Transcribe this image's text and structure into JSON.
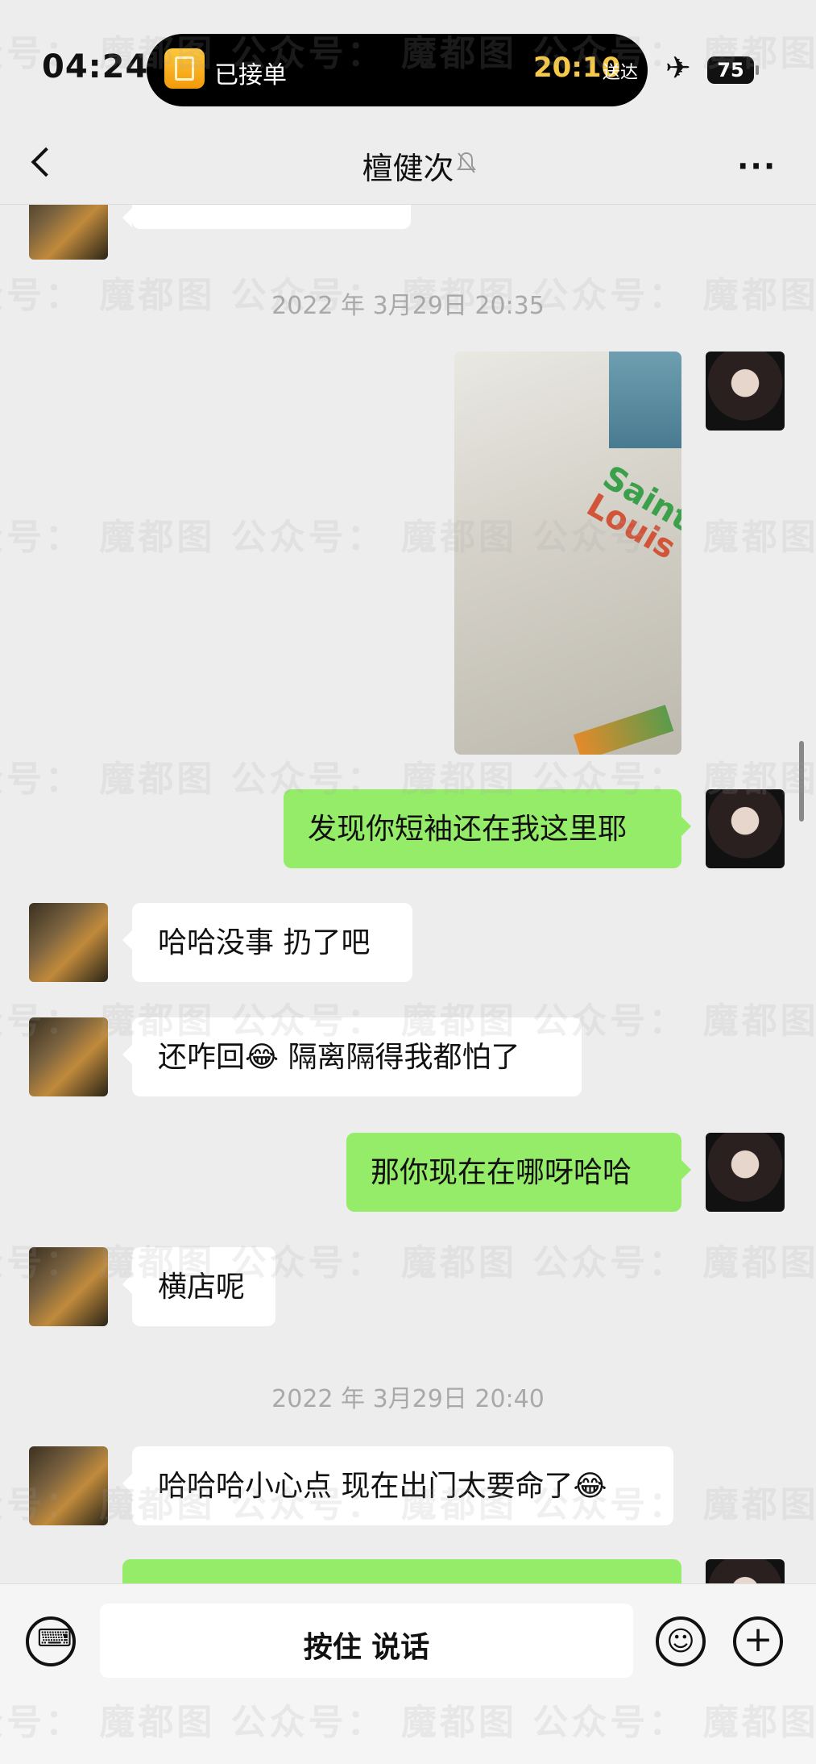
{
  "status_bar": {
    "time": "04:24",
    "island_label": "已接单",
    "island_eta": "20:10",
    "island_eta_suffix": "送达",
    "battery": "75"
  },
  "nav": {
    "title": "檀健次"
  },
  "chat": {
    "items": [
      {
        "type": "timestamp",
        "text": "2022 年 3月29日 20:35"
      },
      {
        "type": "image",
        "from": "self",
        "description": "white t-shirt photo"
      },
      {
        "type": "text",
        "from": "self",
        "text": "发现你短袖还在我这里耶"
      },
      {
        "type": "text",
        "from": "peer",
        "text": "哈哈没事 扔了吧"
      },
      {
        "type": "text",
        "from": "peer",
        "text": "还咋回😂 隔离隔得我都怕了"
      },
      {
        "type": "text",
        "from": "self",
        "text": "那你现在在哪呀哈哈"
      },
      {
        "type": "text",
        "from": "peer",
        "text": "横店呢"
      },
      {
        "type": "timestamp",
        "text": "2022 年 3月29日 20:40"
      },
      {
        "type": "text",
        "from": "peer",
        "text": "哈哈哈小心点 现在出门太要命了😂"
      }
    ],
    "photo_text": [
      "Saint",
      "Louis"
    ]
  },
  "input_bar": {
    "talk_label": "按住 说话"
  },
  "watermark": {
    "text": "众号： 魔都图 公众号： 魔都图 公众号： 魔都图"
  },
  "colors": {
    "self_bubble": "#95ec69",
    "peer_bubble": "#ffffff",
    "background": "#ededed"
  }
}
